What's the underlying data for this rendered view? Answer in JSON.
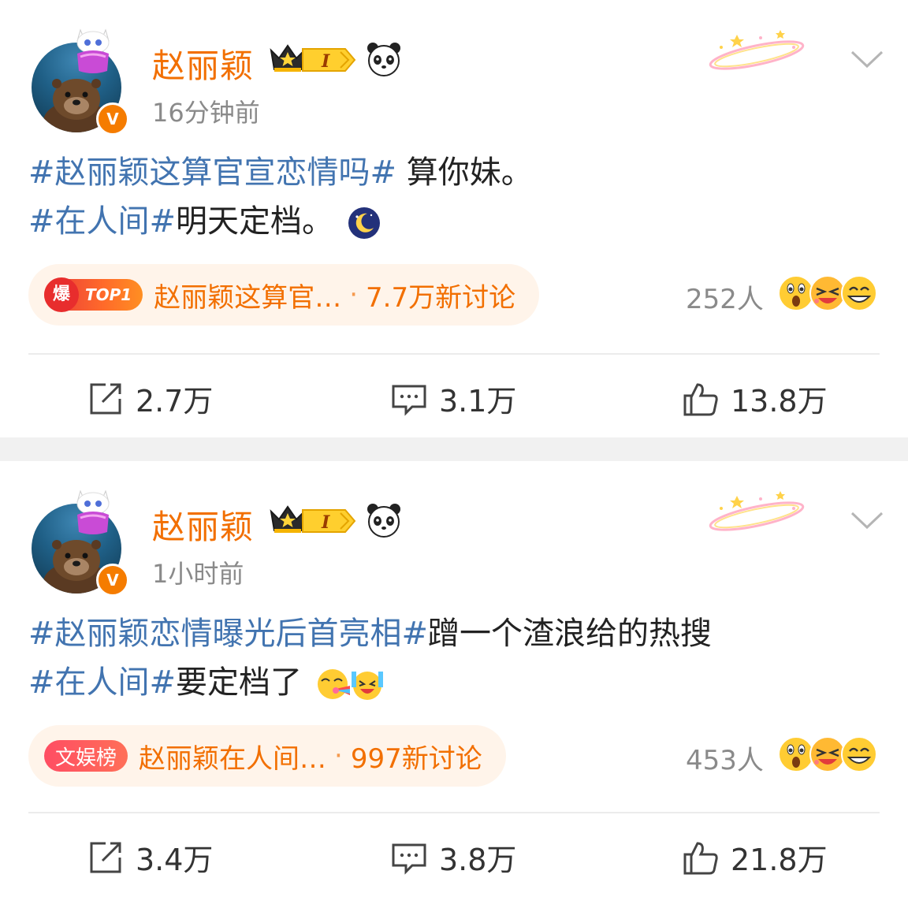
{
  "posts": [
    {
      "username": "赵丽颖",
      "level": "I",
      "timestamp": "16分钟前",
      "content": {
        "line1_hashtag": "#赵丽颖这算官宣恋情吗#",
        "line1_text": " 算你妹。",
        "line2_hashtag": "#在人间#",
        "line2_text": "明天定档。"
      },
      "trend": {
        "tag_char": "爆",
        "tag_label": "TOP1",
        "title": "赵丽颖这算官…",
        "separator": "·",
        "count": "7.7万新讨论"
      },
      "reactions_count": "252人",
      "actions": {
        "repost": "2.7万",
        "comment": "3.1万",
        "like": "13.8万"
      }
    },
    {
      "username": "赵丽颖",
      "level": "I",
      "timestamp": "1小时前",
      "content": {
        "line1_hashtag": "#赵丽颖恋情曝光后首亮相#",
        "line1_text": "蹭一个渣浪给的热搜",
        "line2_hashtag": "#在人间#",
        "line2_text": "要定档了"
      },
      "trend": {
        "tag_label": "文娱榜",
        "title": "赵丽颖在人间…",
        "separator": "·",
        "count": "997新讨论"
      },
      "reactions_count": "453人",
      "actions": {
        "repost": "3.4万",
        "comment": "3.8万",
        "like": "21.8万"
      }
    }
  ],
  "colors": {
    "username": "#f26f00",
    "hashtag": "#4274b0",
    "trend_bg": "#fff4ea",
    "meta": "#8a8a8a",
    "divider": "#f1f1f1"
  },
  "icons": [
    "v-verified-icon",
    "crown-icon",
    "level-badge-icon",
    "panda-icon",
    "sparkle-decoration",
    "chevron-down-icon",
    "moon-emoji-icon",
    "repost-icon",
    "comment-icon",
    "like-icon",
    "surprised-face-icon",
    "laughing-face-icon",
    "grin-face-icon"
  ]
}
